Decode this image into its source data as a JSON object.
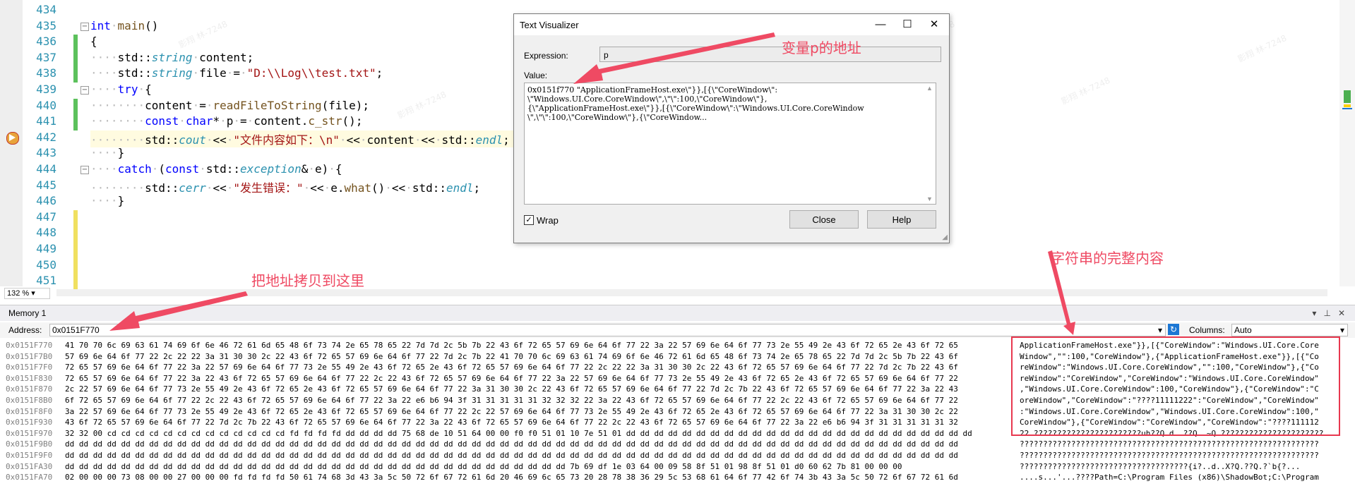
{
  "editor": {
    "lines": [
      {
        "num": "434",
        "code": ""
      },
      {
        "num": "435",
        "code": "int main()"
      },
      {
        "num": "436",
        "code": "{"
      },
      {
        "num": "437",
        "code": "    std::string content;"
      },
      {
        "num": "438",
        "code": "    std::string file = \"D:\\\\Log\\\\test.txt\";"
      },
      {
        "num": "439",
        "code": "    try {"
      },
      {
        "num": "440",
        "code": "        content = readFileToString(file);"
      },
      {
        "num": "441",
        "code": "        const char* p = content.c_str();"
      },
      {
        "num": "442",
        "code": "        std::cout << \"文件内容如下：\\n\" << content << std::endl;"
      },
      {
        "num": "443",
        "code": "    }"
      },
      {
        "num": "444",
        "code": "    catch (const std::exception& e) {"
      },
      {
        "num": "445",
        "code": "        std::cerr << \"发生错误：\" << e.what() << std::endl;"
      },
      {
        "num": "446",
        "code": "    }"
      },
      {
        "num": "447",
        "code": ""
      },
      {
        "num": "448",
        "code": ""
      },
      {
        "num": "449",
        "code": ""
      },
      {
        "num": "450",
        "code": ""
      },
      {
        "num": "451",
        "code": ""
      }
    ],
    "zoom": "132 %"
  },
  "memory": {
    "title": "Memory 1",
    "address_label": "Address:",
    "address_value": "0x0151F770",
    "columns_label": "Columns:",
    "columns_value": "Auto",
    "rows": [
      {
        "addr": "0x0151F770",
        "hex": "41 70 70 6c 69 63 61 74 69 6f 6e 46 72 61 6d 65 48 6f 73 74 2e 65 78 65 22 7d 7d 2c 5b 7b 22 43 6f 72 65 57 69 6e 64 6f 77 22 3a 22 57 69 6e 64 6f 77 73 2e 55 49 2e 43 6f 72 65 2e 43 6f 72 65",
        "ascii": "ApplicationFrameHost.exe\"}},[{\"CoreWindow\":\"Windows.UI.Core.Core"
      },
      {
        "addr": "0x0151F7B0",
        "hex": "57 69 6e 64 6f 77 22 2c 22 22 3a 31 30 30 2c 22 43 6f 72 65 57 69 6e 64 6f 77 22 7d 2c 7b 22 41 70 70 6c 69 63 61 74 69 6f 6e 46 72 61 6d 65 48 6f 73 74 2e 65 78 65 22 7d 7d 2c 5b 7b 22 43 6f",
        "ascii": "Window\",\"\":100,\"CoreWindow\"},{\"ApplicationFrameHost.exe\"}},[{\"Co"
      },
      {
        "addr": "0x0151F7F0",
        "hex": "72 65 57 69 6e 64 6f 77 22 3a 22 57 69 6e 64 6f 77 73 2e 55 49 2e 43 6f 72 65 2e 43 6f 72 65 57 69 6e 64 6f 77 22 2c 22 22 3a 31 30 30 2c 22 43 6f 72 65 57 69 6e 64 6f 77 22 7d 2c 7b 22 43 6f",
        "ascii": "reWindow\":\"Windows.UI.Core.CoreWindow\",\"\":100,\"CoreWindow\"},{\"Co"
      },
      {
        "addr": "0x0151F830",
        "hex": "72 65 57 69 6e 64 6f 77 22 3a 22 43 6f 72 65 57 69 6e 64 6f 77 22 2c 22 43 6f 72 65 57 69 6e 64 6f 77 22 3a 22 57 69 6e 64 6f 77 73 2e 55 49 2e 43 6f 72 65 2e 43 6f 72 65 57 69 6e 64 6f 77 22",
        "ascii": "reWindow\":\"CoreWindow\",\"CoreWindow\":\"Windows.UI.Core.CoreWindow\""
      },
      {
        "addr": "0x0151F870",
        "hex": "2c 22 57 69 6e 64 6f 77 73 2e 55 49 2e 43 6f 72 65 2e 43 6f 72 65 57 69 6e 64 6f 77 22 3a 31 30 30 2c 22 43 6f 72 65 57 69 6e 64 6f 77 22 7d 2c 7b 22 43 6f 72 65 57 69 6e 64 6f 77 22 3a 22 43",
        "ascii": ",\"Windows.UI.Core.CoreWindow\":100,\"CoreWindow\"},{\"CoreWindow\":\"C"
      },
      {
        "addr": "0x0151F8B0",
        "hex": "6f 72 65 57 69 6e 64 6f 77 22 2c 22 43 6f 72 65 57 69 6e 64 6f 77 22 3a 22 e6 b6 94 3f 31 31 31 31 31 32 32 32 22 3a 22 43 6f 72 65 57 69 6e 64 6f 77 22 2c 22 43 6f 72 65 57 69 6e 64 6f 77 22",
        "ascii": "oreWindow\",\"CoreWindow\":\"????11111222\":\"CoreWindow\",\"CoreWindow\""
      },
      {
        "addr": "0x0151F8F0",
        "hex": "3a 22 57 69 6e 64 6f 77 73 2e 55 49 2e 43 6f 72 65 2e 43 6f 72 65 57 69 6e 64 6f 77 22 2c 22 57 69 6e 64 6f 77 73 2e 55 49 2e 43 6f 72 65 2e 43 6f 72 65 57 69 6e 64 6f 77 22 3a 31 30 30 2c 22",
        "ascii": ":\"Windows.UI.Core.CoreWindow\",\"Windows.UI.Core.CoreWindow\":100,\""
      },
      {
        "addr": "0x0151F930",
        "hex": "43 6f 72 65 57 69 6e 64 6f 77 22 7d 2c 7b 22 43 6f 72 65 57 69 6e 64 6f 77 22 3a 22 43 6f 72 65 57 69 6e 64 6f 77 22 2c 22 43 6f 72 65 57 69 6e 64 6f 77 22 3a 22 e6 b6 94 3f 31 31 31 31 31 32",
        "ascii": "CoreWindow\"},{\"CoreWindow\":\"CoreWindow\",\"CoreWindow\":\"????111112"
      },
      {
        "addr": "0x0151F970",
        "hex": "32 32 00 cd cd cd cd cd cd cd cd cd cd cd cd cd fd fd fd fd dd dd dd dd 75 68 de 10 51 64 00 00 f0 f0 51 01 10 7e 51 01 dd dd dd dd dd dd dd dd dd dd dd dd dd dd dd dd dd dd dd dd dd dd dd dd dd",
        "ascii": "22.???????????????????????uh??Q d..??Q..~Q.??????????????????????"
      },
      {
        "addr": "0x0151F9B0",
        "hex": "dd dd dd dd dd dd dd dd dd dd dd dd dd dd dd dd dd dd dd dd dd dd dd dd dd dd dd dd dd dd dd dd dd dd dd dd dd dd dd dd dd dd dd dd dd dd dd dd dd dd dd dd dd dd dd dd dd dd dd dd dd dd dd dd",
        "ascii": "????????????????????????????????????????????????????????????????"
      },
      {
        "addr": "0x0151F9F0",
        "hex": "dd dd dd dd dd dd dd dd dd dd dd dd dd dd dd dd dd dd dd dd dd dd dd dd dd dd dd dd dd dd dd dd dd dd dd dd dd dd dd dd dd dd dd dd dd dd dd dd dd dd dd dd dd dd dd dd dd dd dd dd dd dd dd dd",
        "ascii": "????????????????????????????????????????????????????????????????"
      },
      {
        "addr": "0x0151FA30",
        "hex": "dd dd dd dd dd dd dd dd dd dd dd dd dd dd dd dd dd dd dd dd dd dd dd dd dd dd dd dd dd dd dd dd dd dd dd dd 7b 69 df 1e 03 64 00 09 58 8f 51 01 98 8f 51 01 d0 60 62 7b 81 00 00 00",
        "ascii": "????????????????????????????????????{i?..d..X?Q.??Q.?`b{?..."
      },
      {
        "addr": "0x0151FA70",
        "hex": "02 00 00 00 73 08 00 00 27 00 00 00 fd fd fd fd 50 61 74 68 3d 43 3a 5c 50 72 6f 67 72 61 6d 20 46 69 6c 65 73 20 28 78 38 36 29 5c 53 68 61 64 6f 77 42 6f 74 3b 43 3a 5c 50 72 6f 67 72 61 6d",
        "ascii": "....s...'...????Path=C:\\Program Files (x86)\\ShadowBot;C:\\Program"
      }
    ]
  },
  "dialog": {
    "title": "Text Visualizer",
    "expression_label": "Expression:",
    "expression_value": "p",
    "value_label": "Value:",
    "value_text": "0x0151f770 \"ApplicationFrameHost.exe\\\"}},[{\\\"CoreWindow\\\":\n\\\"Windows.UI.Core.CoreWindow\\\",\\\"\\\":100,\\\"CoreWindow\\\"},\n{\\\"ApplicationFrameHost.exe\\\"}},[{\\\"CoreWindow\\\":\\\"Windows.UI.Core.CoreWindow\n\\\",\\\"\\\":100,\\\"CoreWindow\\\"},{\\\"CoreWindow...",
    "wrap_label": "Wrap",
    "close_label": "Close",
    "help_label": "Help",
    "btn_minimize": "—",
    "btn_maximize": "☐",
    "btn_close": "✕"
  },
  "annotations": {
    "p_address": "变量p的地址",
    "copy_here": "把地址拷贝到这里",
    "full_string": "字符串的完整内容",
    "accent_color": "#ef4a63"
  },
  "watermark": "影翔 林-7248"
}
